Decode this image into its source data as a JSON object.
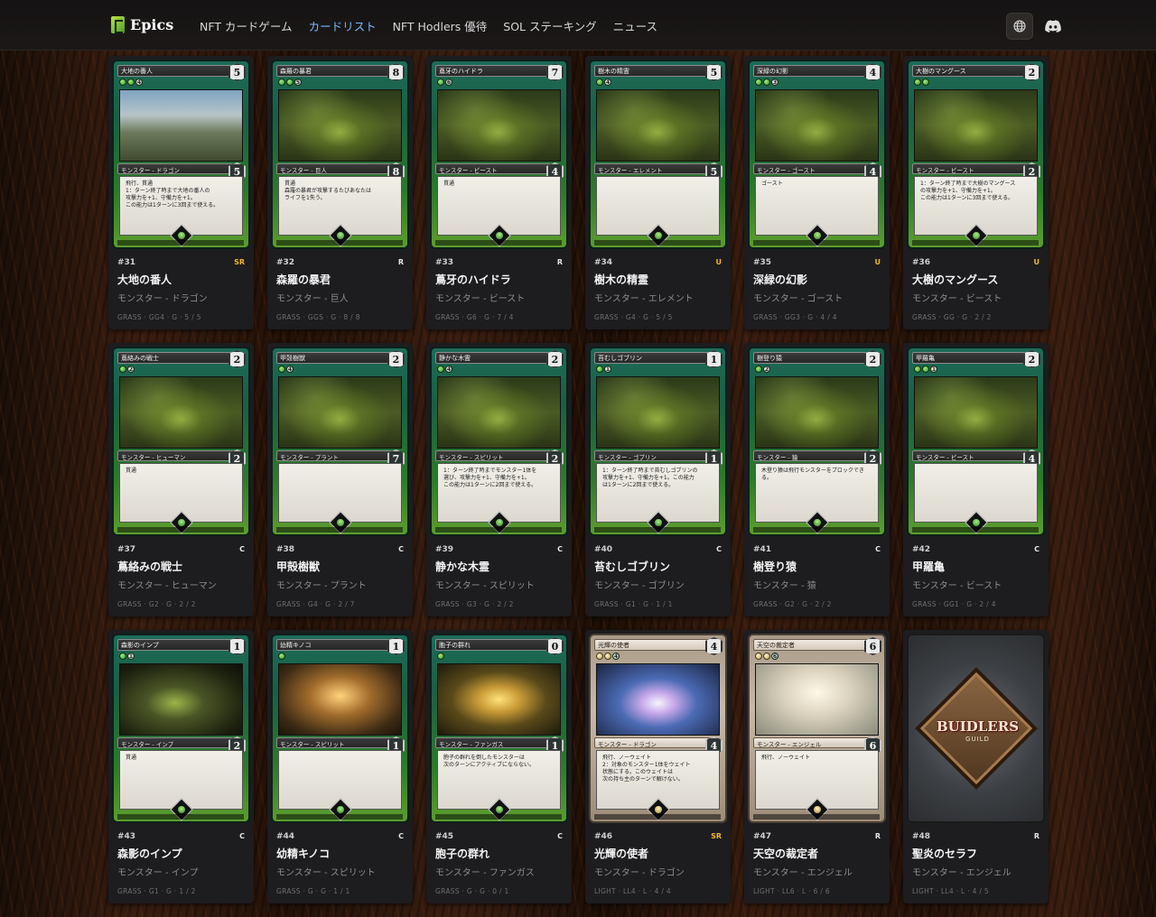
{
  "header": {
    "brand": "Epics",
    "nav": [
      {
        "label": "NFT カードゲーム",
        "active": false
      },
      {
        "label": "カードリスト",
        "active": true
      },
      {
        "label": "NFT Hodlers 優待",
        "active": false
      },
      {
        "label": "SOL ステーキング",
        "active": false
      },
      {
        "label": "ニュース",
        "active": false
      }
    ],
    "icons": {
      "language": "globe-icon",
      "discord": "discord-icon"
    },
    "accent_color": "#7ab8ff"
  },
  "cards": [
    {
      "num": "#31",
      "name": "大地の番人",
      "type": "モンスター - ドラゴン",
      "rarity": "SR",
      "stats": "GRASS · GG4 · G · 5 / 5",
      "cost": "5",
      "power": "5",
      "mana": [
        "g",
        "g",
        "4"
      ],
      "art": "dragon",
      "text": "飛行、貫通\n1：ターン終了時まで大地の番人の\n攻撃力を+1、守備力を+1。\nこの能力は1ターンに3回まで使える。"
    },
    {
      "num": "#32",
      "name": "森羅の暴君",
      "type": "モンスター - 巨人",
      "rarity": "R",
      "stats": "GRASS · GGS · G · 8 / 8",
      "cost": "8",
      "power": "8",
      "mana": [
        "g",
        "g",
        "5"
      ],
      "art": "forest",
      "text": "貫通\n森羅の暴君が攻撃するたびあなたは\nライフを1失う。"
    },
    {
      "num": "#33",
      "name": "蔦牙のハイドラ",
      "type": "モンスター - ビースト",
      "rarity": "R",
      "stats": "GRASS · G6 · G · 7 / 4",
      "cost": "7",
      "power": "4",
      "mana": [
        "g",
        "6"
      ],
      "art": "forest",
      "text": "貫通"
    },
    {
      "num": "#34",
      "name": "樹木の精霊",
      "type": "モンスター - エレメント",
      "rarity": "U",
      "stats": "GRASS · G4 · G · 5 / 5",
      "cost": "5",
      "power": "5",
      "mana": [
        "g",
        "4"
      ],
      "art": "forest",
      "text": ""
    },
    {
      "num": "#35",
      "name": "深緑の幻影",
      "type": "モンスター - ゴースト",
      "rarity": "U",
      "stats": "GRASS · GG3 · G · 4 / 4",
      "cost": "4",
      "power": "4",
      "mana": [
        "g",
        "g",
        "3"
      ],
      "art": "forest",
      "text": "ゴースト"
    },
    {
      "num": "#36",
      "name": "大樹のマングース",
      "type": "モンスター - ビースト",
      "rarity": "U",
      "stats": "GRASS · GG · G · 2 / 2",
      "cost": "2",
      "power": "2",
      "mana": [
        "g",
        "g"
      ],
      "art": "forest",
      "text": "1：ターン終了時まで大樹のマングース\nの攻撃力を+1、守備力を+1。\nこの能力は1ターンに3回まで使える。"
    },
    {
      "num": "#37",
      "name": "蔦絡みの戦士",
      "type": "モンスター - ヒューマン",
      "rarity": "C",
      "stats": "GRASS · G2 · G · 2 / 2",
      "cost": "2",
      "power": "2",
      "mana": [
        "g",
        "2"
      ],
      "art": "forest",
      "text": "貫通"
    },
    {
      "num": "#38",
      "name": "甲殻樹獣",
      "type": "モンスター - プラント",
      "rarity": "C",
      "stats": "GRASS · G4 · G · 2 / 7",
      "cost": "2",
      "power": "7",
      "mana": [
        "g",
        "4"
      ],
      "art": "forest",
      "text": ""
    },
    {
      "num": "#39",
      "name": "静かな木霊",
      "type": "モンスター - スピリット",
      "rarity": "C",
      "stats": "GRASS · G3 · G · 2 / 2",
      "cost": "2",
      "power": "2",
      "mana": [
        "g",
        "4"
      ],
      "art": "forest",
      "text": "1：ターン終了時までモンスター1体を\n選び、攻撃力を+1、守備力を+1。\nこの能力は1ターンに2回まで使える。"
    },
    {
      "num": "#40",
      "name": "苔むしゴブリン",
      "type": "モンスター - ゴブリン",
      "rarity": "C",
      "stats": "GRASS · G1 · G · 1 / 1",
      "cost": "1",
      "power": "1",
      "mana": [
        "g",
        "1"
      ],
      "art": "forest",
      "text": "1：ターン終了時まで苔むしゴブリンの\n攻撃力を+1、守備力を+1。この能力\nは1ターンに2回まで使える。"
    },
    {
      "num": "#41",
      "name": "樹登り猿",
      "type": "モンスター - 猿",
      "rarity": "C",
      "stats": "GRASS · G2 · G · 2 / 2",
      "cost": "2",
      "power": "2",
      "mana": [
        "g",
        "2"
      ],
      "art": "forest",
      "text": "木登り猿は飛行モンスターをブロックできる。"
    },
    {
      "num": "#42",
      "name": "甲羅亀",
      "type": "モンスター - ビースト",
      "rarity": "C",
      "stats": "GRASS · GG1 · G · 2 / 4",
      "cost": "2",
      "power": "4",
      "mana": [
        "g",
        "g",
        "1"
      ],
      "art": "forest",
      "text": ""
    },
    {
      "num": "#43",
      "name": "森影のインプ",
      "type": "モンスター - インプ",
      "rarity": "C",
      "stats": "GRASS · G1 · G · 1 / 2",
      "cost": "1",
      "power": "2",
      "mana": [
        "g",
        "1"
      ],
      "art": "imp",
      "text": "貫通"
    },
    {
      "num": "#44",
      "name": "幼精キノコ",
      "type": "モンスター - スピリット",
      "rarity": "C",
      "stats": "GRASS · G · G · 1 / 1",
      "cost": "1",
      "power": "1",
      "mana": [
        "g"
      ],
      "art": "mushroom",
      "text": ""
    },
    {
      "num": "#45",
      "name": "胞子の群れ",
      "type": "モンスター - ファンガス",
      "rarity": "C",
      "stats": "GRASS · G · G · 0 / 1",
      "cost": "0",
      "power": "1",
      "mana": [
        "g"
      ],
      "art": "spores",
      "text": "胞子の群れを倒したモンスターは\n次のターンにアクティブにならない。"
    },
    {
      "num": "#46",
      "name": "光輝の使者",
      "type": "モンスター - ドラゴン",
      "rarity": "SR",
      "stats": "LIGHT · LL4 · L · 4 / 4",
      "cost": "4",
      "power": "4",
      "mana": [
        "l",
        "l",
        "4"
      ],
      "art": "light-dragon",
      "light": true,
      "text": "飛行、ノーウェイト\n2：対象のモンスター1体をウェイト\n状態にする。このウェイトは\n次の持ち主のターンで解けない。"
    },
    {
      "num": "#47",
      "name": "天空の裁定者",
      "type": "モンスター - エンジェル",
      "rarity": "R",
      "stats": "LIGHT · LL6 · L · 6 / 6",
      "cost": "6",
      "power": "6",
      "mana": [
        "l",
        "l",
        "6"
      ],
      "art": "light-angel",
      "light": true,
      "text": "飛行、ノーウェイト"
    },
    {
      "num": "#48",
      "name": "聖炎のセラフ",
      "type": "モンスター - エンジェル",
      "rarity": "R",
      "stats": "LIGHT · LL4 · L · 4 / 5",
      "back": true,
      "back_title": "BUIDLERS",
      "back_sub": "GUILD"
    }
  ]
}
